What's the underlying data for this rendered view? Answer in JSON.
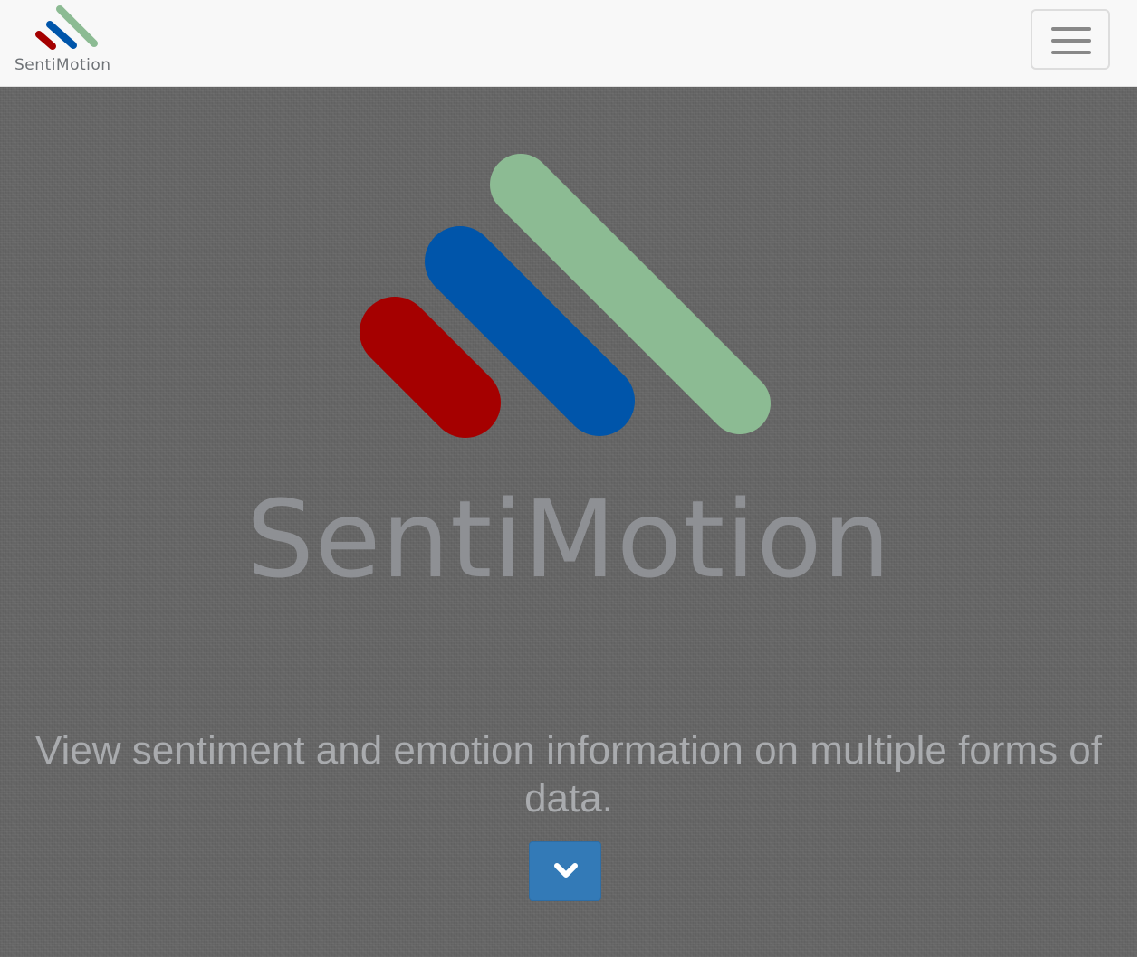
{
  "navbar": {
    "brand_text": "SentiMotion",
    "menu_icon": "hamburger-menu-icon"
  },
  "hero": {
    "wordmark": "SentiMotion",
    "tagline": "View sentiment and emotion information on multiple forms of data.",
    "scroll_icon": "chevron-down-icon"
  },
  "colors": {
    "logo_red": "#a50000",
    "logo_blue": "#0055aa",
    "logo_green": "#8cbb93",
    "button_primary": "#337ab7",
    "hero_background": "#656565",
    "navbar_background": "#f8f8f8"
  }
}
